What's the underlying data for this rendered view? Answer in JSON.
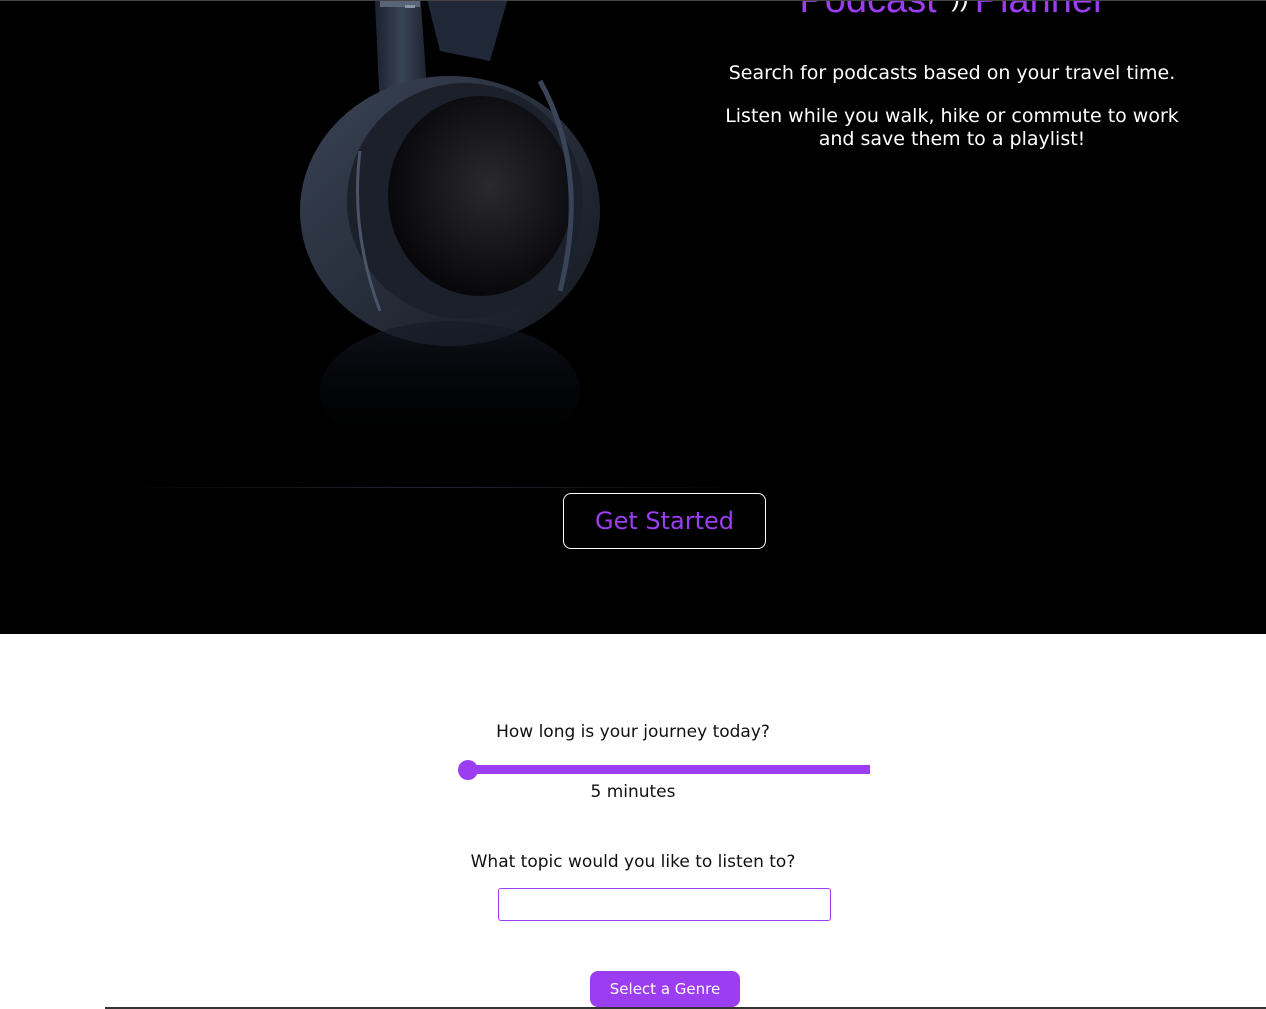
{
  "hero": {
    "brand_left": "Podcast",
    "brand_right": "Planner",
    "brand_icon": "sound-waves-icon",
    "tagline_1": "Search for podcasts based on your travel time.",
    "tagline_2": "Listen while you walk, hike or commute to work and save them to a playlist!",
    "cta_label": "Get Started"
  },
  "form": {
    "journey_question": "How long is your journey today?",
    "journey_value": 5,
    "journey_min": 5,
    "journey_value_label": "5 minutes",
    "topic_question": "What topic would you like to listen to?",
    "topic_value": "",
    "genre_button_label": "Select a Genre"
  },
  "colors": {
    "accent": "#9b3df0",
    "hero_background": "#000000",
    "page_background": "#ffffff"
  }
}
